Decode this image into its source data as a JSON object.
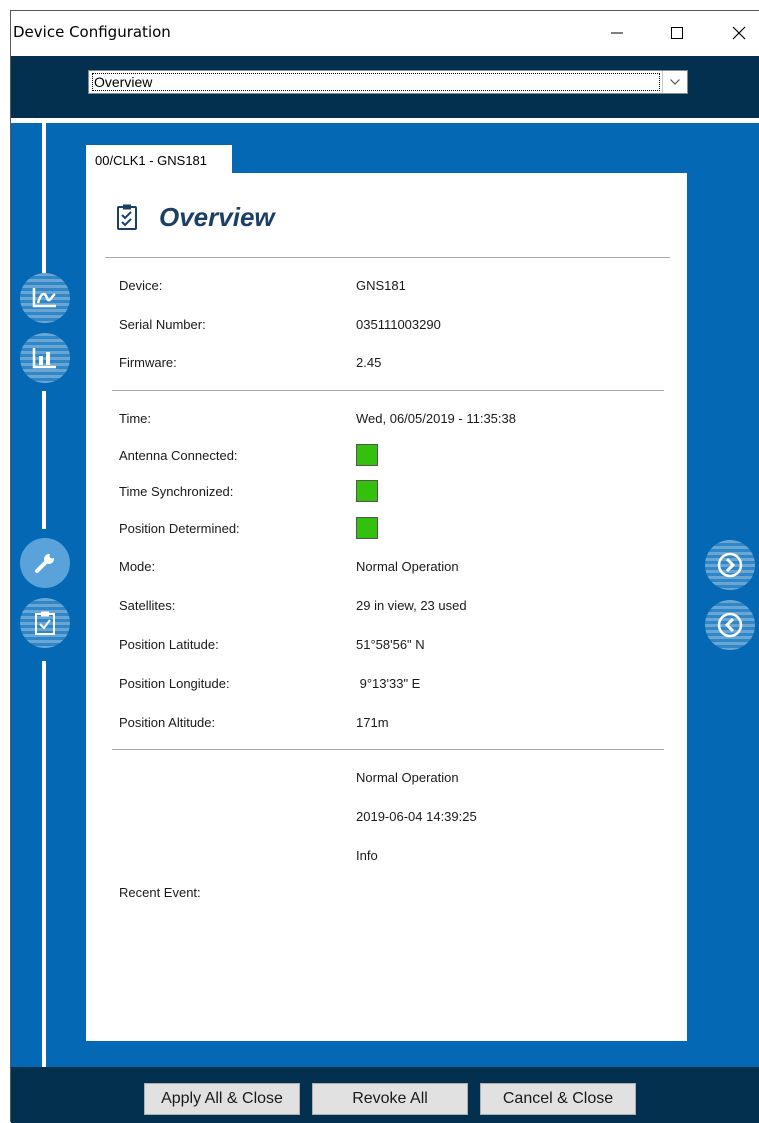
{
  "window": {
    "title": "Device Configuration"
  },
  "view_select": {
    "value": "Overview"
  },
  "tab": {
    "label": "00/CLK1 - GNS181"
  },
  "overview": {
    "title": "Overview",
    "device": {
      "label": "Device:",
      "value": "GNS181"
    },
    "serial": {
      "label": "Serial Number:",
      "value": "035111003290"
    },
    "firmware": {
      "label": "Firmware:",
      "value": "2.45"
    },
    "time": {
      "label": "Time:",
      "value": "Wed, 06/05/2019 - 11:35:38"
    },
    "antenna": {
      "label": "Antenna Connected:",
      "status": "ok",
      "color": "#33c10e"
    },
    "sync": {
      "label": "Time Synchronized:",
      "status": "ok",
      "color": "#33c10e"
    },
    "position": {
      "label": "Position Determined:",
      "status": "ok",
      "color": "#33c10e"
    },
    "mode": {
      "label": "Mode:",
      "value": "Normal Operation"
    },
    "satellites": {
      "label": "Satellites:",
      "value": "29 in view, 23 used"
    },
    "latitude": {
      "label": "Position Latitude:",
      "value": "51°58'56\" N"
    },
    "longitude": {
      "label": "Position Longitude:",
      "value": " 9°13'33\" E"
    },
    "altitude": {
      "label": "Position Altitude:",
      "value": "171m"
    },
    "recent_event": {
      "label": "Recent Event:",
      "lines": [
        "Normal Operation",
        "2019-06-04 14:39:25",
        "Info"
      ]
    }
  },
  "side_icons": {
    "left": [
      "signal-graph-icon",
      "chart-icon",
      "wrench-icon",
      "clipboard-check-icon"
    ],
    "right": [
      "next-icon",
      "previous-icon"
    ]
  },
  "footer": {
    "apply_label": "Apply All & Close",
    "revoke_label": "Revoke All",
    "cancel_label": "Cancel & Close"
  },
  "colors": {
    "header_band": "#03304f",
    "main_blue": "#0468b4",
    "title_text": "#1c3f66",
    "status_ok": "#33c10e"
  }
}
